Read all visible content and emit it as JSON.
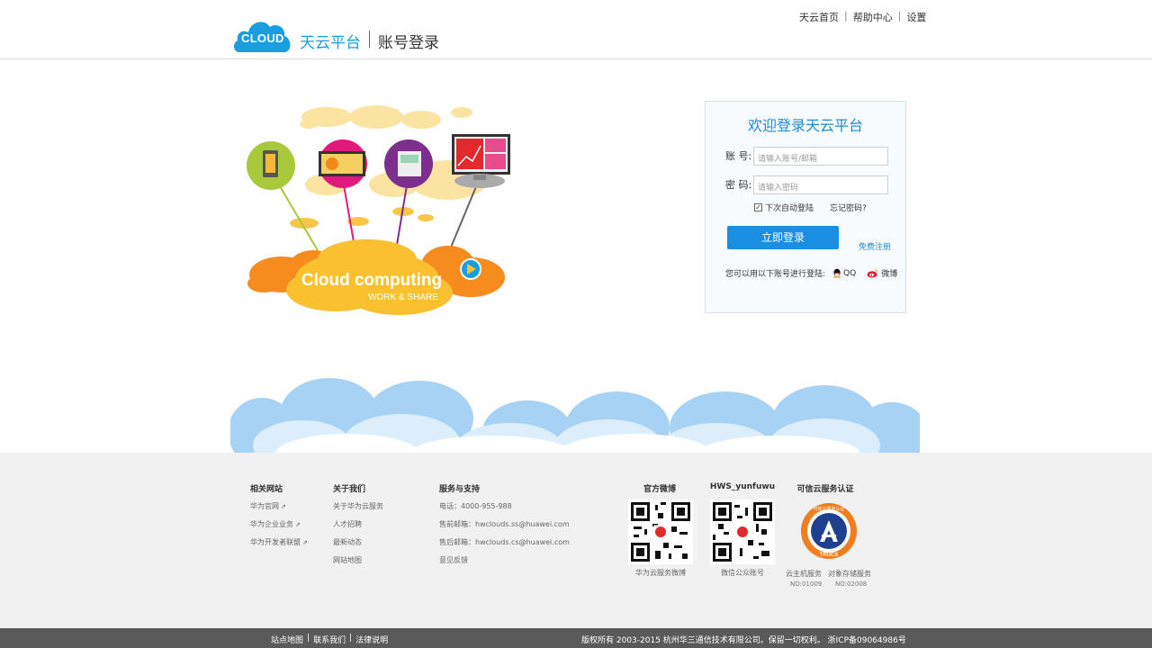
{
  "header": {
    "logo_text": "CLOUD",
    "brand": "天云平台",
    "subtitle": "账号登录",
    "links": [
      "天云首页",
      "帮助中心",
      "设置"
    ]
  },
  "hero": {
    "headline": "Cloud computing",
    "tagline": "WORK & SHARE"
  },
  "login": {
    "title": "欢迎登录天云平台",
    "account_label": "账  号:",
    "account_placeholder": "请输入账号/邮箱",
    "password_label": "密  码:",
    "password_placeholder": "请输入密码",
    "remember_label": "下次自动登陆",
    "remember_checked": true,
    "forgot_label": "忘记密码?",
    "submit_label": "立即登录",
    "register_label": "免费注册",
    "third_party_prompt": "您可以用以下账号进行登陆:",
    "qq_label": "QQ",
    "weibo_label": "微博"
  },
  "footer": {
    "related": {
      "title": "相关网站",
      "links": [
        "华为官网",
        "华为企业业务",
        "华为开发者联盟"
      ]
    },
    "about": {
      "title": "关于我们",
      "links": [
        "关于华为云服务",
        "人才招聘",
        "最新动态",
        "网站地图"
      ]
    },
    "support": {
      "title": "服务与支持",
      "items": [
        "电话：4000-955-988",
        "售前邮箱：hwclouds.ss@huawei.com",
        "售后邮箱：hwclouds.cs@huawei.com",
        "意见反馈"
      ]
    },
    "weibo": {
      "title": "官方微博",
      "caption": "华为云服务微博"
    },
    "wechat": {
      "title": "HWS_yunfuwu",
      "caption": "微信公众账号"
    },
    "cert": {
      "title": "可信云服务认证",
      "badge_top": "可信云服务认证",
      "badge_bottom": "TRUCS",
      "items": [
        {
          "name": "云主机服务",
          "no": "NO:01009"
        },
        {
          "name": "对象存储服务",
          "no": "NO:02008"
        }
      ]
    }
  },
  "bottom_bar": {
    "links": [
      "站点地图",
      "联系我们",
      "法律说明"
    ],
    "copyright": "版权所有 2003-2015 杭州华三通信技术有限公司。保留一切权利。 浙ICP备09064986号"
  },
  "colors": {
    "brand_blue": "#1a9ee0",
    "button_blue": "#1a8ee0",
    "footer_bg": "#f1f1f1",
    "bottom_bar": "#5a5a5a",
    "cert_orange": "#f07d1e"
  }
}
